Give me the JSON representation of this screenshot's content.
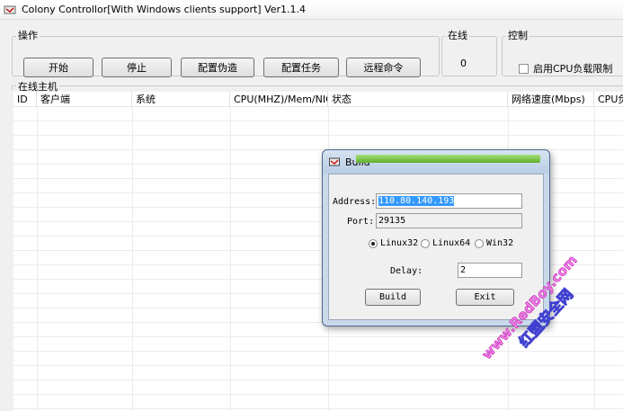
{
  "window": {
    "title": "Colony Controllor[With Windows clients support] Ver1.1.4"
  },
  "operations": {
    "legend": "操作",
    "buttons": [
      "开始",
      "停止",
      "配置伪造",
      "配置任务",
      "远程命令"
    ]
  },
  "online": {
    "legend": "在线",
    "count": "0"
  },
  "control": {
    "legend": "控制",
    "cpu_limit_label": "启用CPU负载限制",
    "cpu_limit_checked": false
  },
  "hosts": {
    "legend": "在线主机",
    "columns": [
      "ID",
      "客户端",
      "系统",
      "CPU(MHZ)/Mem/NIC",
      "状态",
      "网络速度(Mbps)",
      "CPU负"
    ],
    "rows": []
  },
  "build_dialog": {
    "title": "Build",
    "address_label": "Address:",
    "address_value": "110.80.140.193",
    "port_label": "Port:",
    "port_value": "29135",
    "platforms": [
      {
        "label": "Linux32",
        "selected": true
      },
      {
        "label": "Linux64",
        "selected": false
      },
      {
        "label": "Win32",
        "selected": false
      }
    ],
    "delay_label": "Delay:",
    "delay_value": "2",
    "build_label": "Build",
    "exit_label": "Exit"
  },
  "watermark": {
    "line1": "www.RedBoy.com",
    "line2": "红盟安全网"
  },
  "colors": {
    "progress": "#5fb02c",
    "selection": "#3399ff",
    "watermark": "#e03cd0",
    "dialog_frame": "#c9d8ea"
  }
}
